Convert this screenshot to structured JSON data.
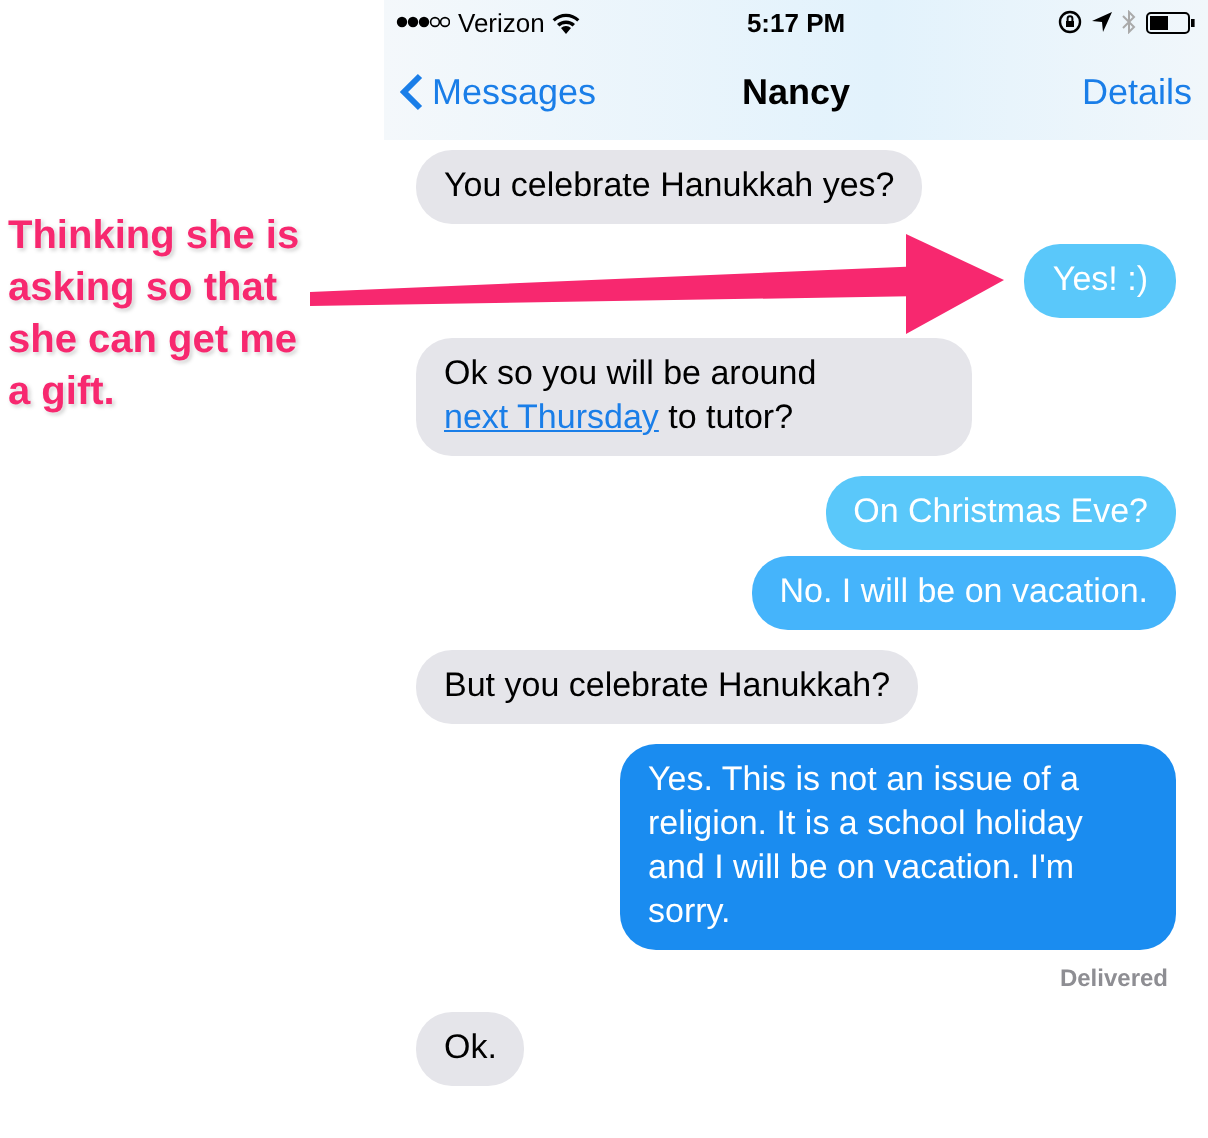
{
  "annotation": {
    "text": "Thinking she is asking so that she can get me a gift."
  },
  "status_bar": {
    "carrier": "Verizon",
    "time": "5:17 PM"
  },
  "nav_bar": {
    "back": "Messages",
    "title": "Nancy",
    "action": "Details"
  },
  "messages": [
    {
      "kind": "incoming",
      "color": "#e5e5ea",
      "parts": [
        {
          "text": "You celebrate Hanukkah yes?"
        }
      ]
    },
    {
      "kind": "outgoing",
      "color": "#5ac8fa",
      "parts": [
        {
          "text": "Yes! :)"
        }
      ]
    },
    {
      "kind": "incoming",
      "color": "#e5e5ea",
      "parts": [
        {
          "text": "Ok so you will be around "
        },
        {
          "text": "next Thursday",
          "link": true
        },
        {
          "text": " to tutor?"
        }
      ]
    },
    {
      "kind": "outgoing",
      "color": "#5ac8fa",
      "parts": [
        {
          "text": "On Christmas Eve?"
        }
      ]
    },
    {
      "kind": "outgoing",
      "color": "#45b4fb",
      "parts": [
        {
          "text": "No. I will be on vacation."
        }
      ]
    },
    {
      "kind": "incoming",
      "color": "#e5e5ea",
      "parts": [
        {
          "text": "But you celebrate Hanukkah?"
        }
      ]
    },
    {
      "kind": "outgoing",
      "color": "#1a8cf0",
      "parts": [
        {
          "text": "Yes. This is not an issue of a religion. It is a school holiday and I will be on vacation. I'm sorry."
        }
      ],
      "status": "Delivered"
    },
    {
      "kind": "incoming",
      "color": "#e5e5ea",
      "parts": [
        {
          "text": "Ok."
        }
      ]
    }
  ]
}
